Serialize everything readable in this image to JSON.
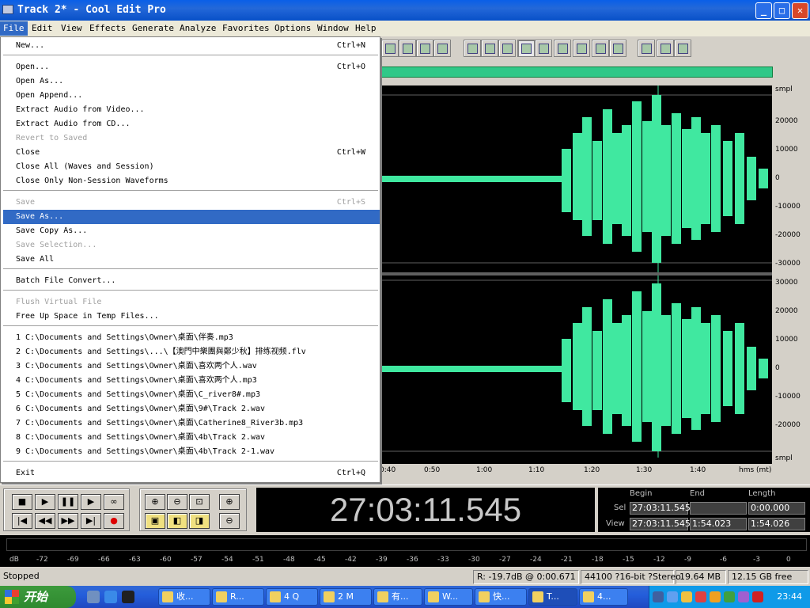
{
  "window": {
    "title": "Track 2* - Cool Edit Pro",
    "min": "_",
    "max": "□",
    "close": "✕"
  },
  "menubar": [
    {
      "label": "File"
    },
    {
      "label": "Edit"
    },
    {
      "label": "View"
    },
    {
      "label": "Effects"
    },
    {
      "label": "Generate"
    },
    {
      "label": "Analyze"
    },
    {
      "label": "Favorites"
    },
    {
      "label": "Options"
    },
    {
      "label": "Window"
    },
    {
      "label": "Help"
    }
  ],
  "file_menu": [
    {
      "label": "New...",
      "shortcut": "Ctrl+N"
    },
    {
      "sep": true
    },
    {
      "label": "Open...",
      "shortcut": "Ctrl+O"
    },
    {
      "label": "Open As..."
    },
    {
      "label": "Open Append..."
    },
    {
      "label": "Extract Audio from Video..."
    },
    {
      "label": "Extract Audio from CD..."
    },
    {
      "label": "Revert to Saved",
      "disabled": true
    },
    {
      "label": "Close",
      "shortcut": "Ctrl+W"
    },
    {
      "label": "Close All (Waves and Session)"
    },
    {
      "label": "Close Only Non-Session Waveforms"
    },
    {
      "sep": true
    },
    {
      "label": "Save",
      "shortcut": "Ctrl+S",
      "disabled": true
    },
    {
      "label": "Save As...",
      "selected": true
    },
    {
      "label": "Save Copy As..."
    },
    {
      "label": "Save Selection...",
      "disabled": true
    },
    {
      "label": "Save All"
    },
    {
      "sep": true
    },
    {
      "label": "Batch File Convert..."
    },
    {
      "sep": true
    },
    {
      "label": "Flush Virtual File",
      "disabled": true
    },
    {
      "label": "Free Up Space in Temp Files..."
    },
    {
      "sep": true
    },
    {
      "label": "1 C:\\Documents and Settings\\Owner\\桌面\\伴奏.mp3"
    },
    {
      "label": "2 C:\\Documents and Settings\\...\\【澳門中樂團與鄭少秋】排练视频.flv"
    },
    {
      "label": "3 C:\\Documents and Settings\\Owner\\桌面\\喜欢两个人.wav"
    },
    {
      "label": "4 C:\\Documents and Settings\\Owner\\桌面\\喜欢两个人.mp3"
    },
    {
      "label": "5 C:\\Documents and Settings\\Owner\\桌面\\C_river8#.mp3"
    },
    {
      "label": "6 C:\\Documents and Settings\\Owner\\桌面\\9#\\Track 2.wav"
    },
    {
      "label": "7 C:\\Documents and Settings\\Owner\\桌面\\Catherine8_River3b.mp3"
    },
    {
      "label": "8 C:\\Documents and Settings\\Owner\\桌面\\4b\\Track 2.wav"
    },
    {
      "label": "9 C:\\Documents and Settings\\Owner\\桌面\\4b\\Track 2-1.wav"
    },
    {
      "sep": true
    },
    {
      "label": "Exit",
      "shortcut": "Ctrl+Q"
    }
  ],
  "amplitude_ch1": [
    "smpl",
    "20000",
    "10000",
    "0",
    "-10000",
    "-20000",
    "-30000"
  ],
  "amplitude_ch2": [
    "30000",
    "20000",
    "10000",
    "0",
    "-10000",
    "-20000",
    "smpl"
  ],
  "time_axis": [
    "0:40",
    "0:50",
    "1:00",
    "1:10",
    "1:20",
    "1:30",
    "1:40",
    "hms (mt)"
  ],
  "transport": {
    "stop": "■",
    "play": "▶",
    "pause": "❚❚",
    "play_to_end": "▶",
    "loop": "∞",
    "rewind_start": "|◀",
    "rewind": "◀◀",
    "forward": "▶▶",
    "forward_end": "▶|",
    "record": "●",
    "zoom_in_h": "⊕",
    "zoom_out_h": "⊖",
    "zoom_full": "⊡",
    "zoom_in_v": "⊕",
    "zoom_sel": "▣",
    "zoom_left": "◧",
    "zoom_right": "◨",
    "zoom_out_v": "⊖"
  },
  "clock": "27:03:11.545",
  "selection": {
    "begin_label": "Begin",
    "end_label": "End",
    "length_label": "Length",
    "sel_label": "Sel",
    "view_label": "View",
    "sel_begin": "27:03:11.545",
    "sel_end": "",
    "sel_length": "0:00.000",
    "view_begin": "27:03:11.545",
    "view_end": "1:54.023",
    "view_length": "1:54.026"
  },
  "meter_ticks": [
    "dB",
    "-72",
    "-69",
    "-66",
    "-63",
    "-60",
    "-57",
    "-54",
    "-51",
    "-48",
    "-45",
    "-42",
    "-39",
    "-36",
    "-33",
    "-30",
    "-27",
    "-24",
    "-21",
    "-18",
    "-15",
    "-12",
    "-9",
    "-6",
    "-3",
    "0"
  ],
  "status": {
    "state": "Stopped",
    "level": "R: -19.7dB @  0:00.671",
    "format": "44100 ?16-bit ?Stereo",
    "size": "19.64 MB",
    "free": "12.15 GB free"
  },
  "taskbar": {
    "start": "开始",
    "clock": "23:44",
    "tasks": [
      {
        "label": "收..."
      },
      {
        "label": "R..."
      },
      {
        "label": "4 Q"
      },
      {
        "label": "2 M"
      },
      {
        "label": "有..."
      },
      {
        "label": "W..."
      },
      {
        "label": "快..."
      },
      {
        "label": "T..."
      },
      {
        "label": "4..."
      }
    ]
  },
  "colors": {
    "wave": "#40e8a0",
    "menu_highlight": "#316ac5",
    "title": "#0a5fe8"
  }
}
